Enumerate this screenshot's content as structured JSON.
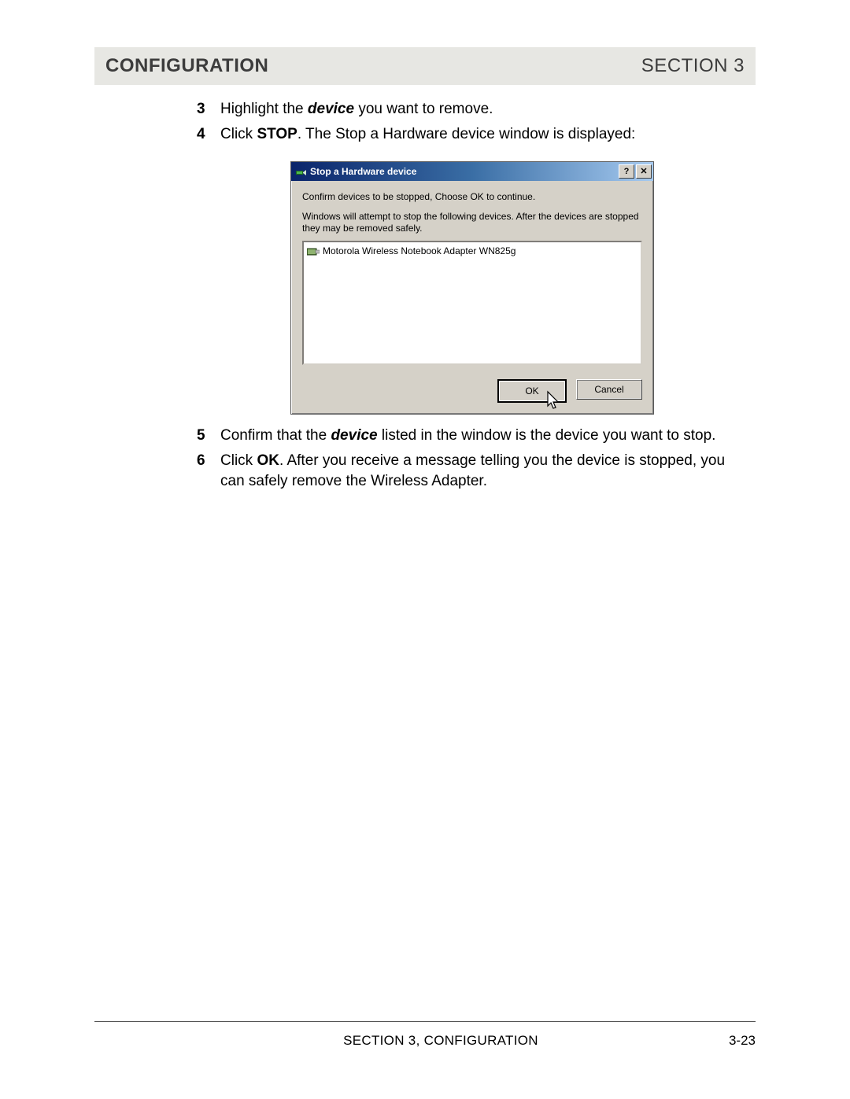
{
  "header": {
    "title": "CONFIGURATION",
    "section": "SECTION 3"
  },
  "steps": [
    {
      "num": "3",
      "parts": [
        {
          "t": "Highlight the "
        },
        {
          "t": "device",
          "cls": "bi"
        },
        {
          "t": " you want to remove."
        }
      ]
    },
    {
      "num": "4",
      "parts": [
        {
          "t": "Click "
        },
        {
          "t": "STOP",
          "cls": "b"
        },
        {
          "t": ". The Stop a Hardware device window is displayed:"
        }
      ]
    }
  ],
  "dialog": {
    "title": "Stop a Hardware device",
    "help_label": "?",
    "close_label": "✕",
    "line1": "Confirm devices to be stopped, Choose OK to continue.",
    "line2": "Windows will attempt to stop the following devices. After the devices are stopped they may be removed safely.",
    "device_item": "Motorola Wireless Notebook Adapter WN825g",
    "ok_label": "OK",
    "cancel_label": "Cancel"
  },
  "steps_after": [
    {
      "num": "5",
      "parts": [
        {
          "t": "Confirm that the "
        },
        {
          "t": "device",
          "cls": "bi"
        },
        {
          "t": " listed in the window is the device you want to stop."
        }
      ]
    },
    {
      "num": "6",
      "parts": [
        {
          "t": "Click "
        },
        {
          "t": "OK",
          "cls": "b"
        },
        {
          "t": ". After you receive a message telling you the device is stopped, you can safely remove the Wireless Adapter."
        }
      ]
    }
  ],
  "footer": {
    "left": "SECTION 3, CONFIGURATION",
    "right": "3-23"
  }
}
